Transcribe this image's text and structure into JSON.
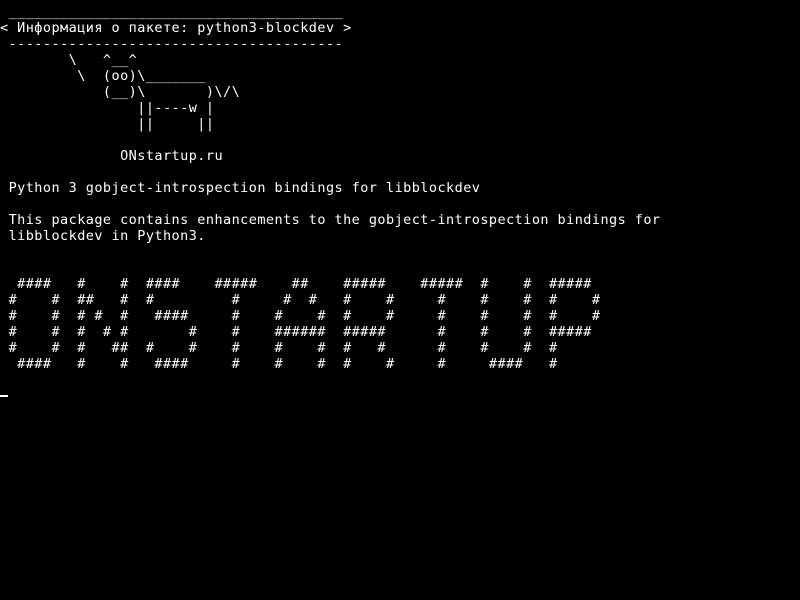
{
  "terminal": {
    "lines": [
      " _______________________________________",
      "< Информация о пакете: python3-blockdev >",
      " ---------------------------------------",
      "        \\   ^__^",
      "         \\  (oo)\\_______",
      "            (__)\\       )\\/\\",
      "                ||----w |",
      "                ||     ||",
      "",
      "              ONstartup.ru",
      "",
      " Python 3 gobject-introspection bindings for libblockdev",
      "",
      " This package contains enhancements to the gobject-introspection bindings for",
      " libblockdev in Python3.",
      "",
      "",
      "  ####   #    #  ####    #####    ##    #####    #####  #    #  #####",
      " #    #  ##   #  #         #     #  #   #    #     #    #    #  #    #",
      " #    #  # #  #   ####     #    #    #  #    #     #    #    #  #    #",
      " #    #  #  # #       #    #    ######  #####      #    #    #  #####",
      " #    #  #   ##  #    #    #    #    #  #   #      #    #    #  #",
      "  ####   #    #   ####     #    #    #  #    #     #     ####   #"
    ],
    "cursor": "_"
  }
}
